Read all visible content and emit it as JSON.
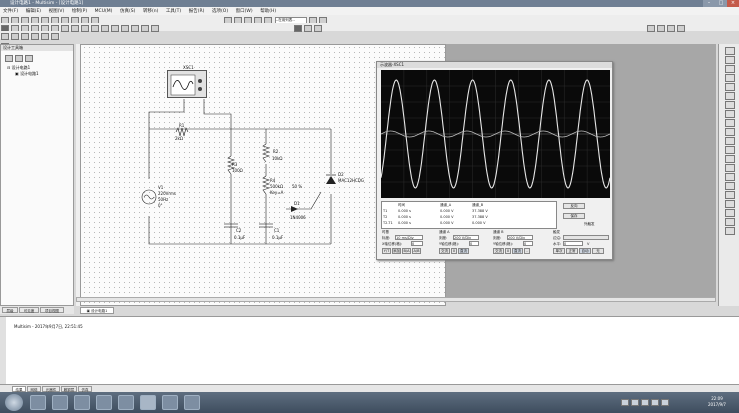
{
  "window": {
    "title": "设计电路1 - Multisim - [设计电路1]"
  },
  "menu": [
    "文件(F)",
    "编辑(E)",
    "视图(V)",
    "绘制(P)",
    "MCU(M)",
    "仿真(S)",
    "转移(n)",
    "工具(T)",
    "报告(R)",
    "选项(O)",
    "窗口(W)",
    "帮助(H)"
  ],
  "toolbar": {
    "in_use_list": "--在用列表--"
  },
  "design_toolbox": {
    "title": "设计工具箱",
    "root": "设计电路1",
    "child": "设计电路1"
  },
  "left_tabs": [
    "层级",
    "可见度",
    "项目视图"
  ],
  "sheet_tab": "设计电路1",
  "components": {
    "xsc1": "XSC1",
    "r1": "R1",
    "r1_val": "2kΩ",
    "r2": "R2",
    "r2_val": "10kΩ",
    "r3": "R3",
    "r3_val": "100Ω",
    "r4": "R4",
    "r4_val": "500kΩ",
    "r4_pct": "50 %",
    "r4_key": "Key=A",
    "v1": "V1",
    "v1_v": "220Vrms",
    "v1_f": "50Hz",
    "v1_p": "0°",
    "c2": "C2",
    "c2_val": "0.1μF",
    "c1": "C1",
    "c1_val": "0.1μF",
    "d1": "D1",
    "d1_val": "1N4006",
    "d2": "D2",
    "d2_val": "MAC12HCDG"
  },
  "scope": {
    "title": "示波器-XSC1",
    "t1": "T1",
    "t2": "T2",
    "t2t1": "T2-T1",
    "col_time": "时间",
    "col_cha": "通道_A",
    "col_chb": "通道_B",
    "t1_time": "0.000 s",
    "t1_a": "0.000 V",
    "t1_b": "37.388 V",
    "t2_time": "0.000 s",
    "t2_a": "0.000 V",
    "t2_b": "37.388 V",
    "d_time": "0.000 s",
    "d_a": "0.000 V",
    "d_b": "0.000 V",
    "reverse": "反向",
    "save": "保存",
    "ext_trigger": "外触发",
    "timebase": "时基",
    "timebase_scale_lbl": "标度:",
    "timebase_scale": "10 ms/Div",
    "timebase_x_lbl": "X轴位移(格):",
    "timebase_x": "0",
    "cha": "通道 A",
    "cha_scale": "200 V/Div",
    "cha_y_lbl": "Y轴位移(格):",
    "cha_y": "0",
    "chb": "通道 B",
    "chb_scale": "200 V/Div",
    "chb_y": "0",
    "trigger": "触发",
    "edge_lbl": "边沿:",
    "level_lbl": "水平:",
    "level": "0",
    "unit_v": "V",
    "btns": [
      "Y/T",
      "添加",
      "B/A",
      "A/B"
    ],
    "btns_a": [
      "交流",
      "0",
      "直流"
    ],
    "btns_b": [
      "交流",
      "0",
      "直流",
      "-"
    ],
    "trig_btns": [
      "单次",
      "正常",
      "自动",
      "无"
    ],
    "scale_lbl": "刻度:"
  },
  "log": {
    "app": "Multisim",
    "time": "2017年9月7日, 22:51:45"
  },
  "bottom_tabs": [
    "结果",
    "网络",
    "元器件",
    "敷铜层",
    "仿真"
  ],
  "clock": {
    "time": "22:09",
    "date": "2017/9/7"
  }
}
